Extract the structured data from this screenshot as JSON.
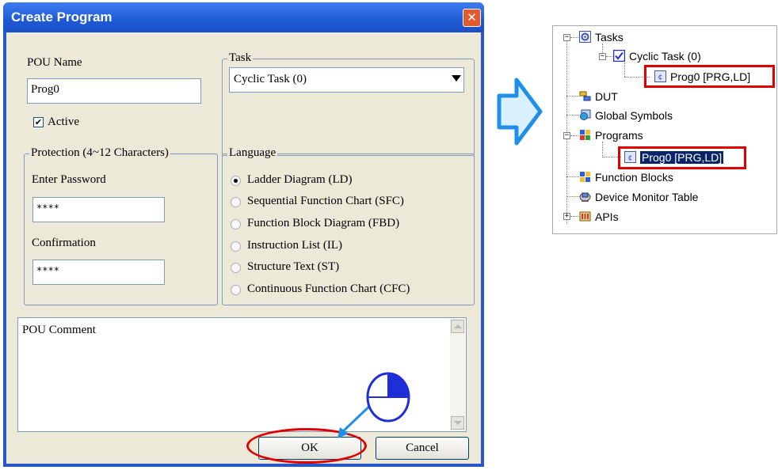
{
  "dialog": {
    "title": "Create Program",
    "close_glyph": "✕",
    "pou_name_label": "POU Name",
    "pou_name_value": "Prog0",
    "active_label": "Active",
    "active_checked": true,
    "task": {
      "legend": "Task",
      "selected": "Cyclic Task (0)"
    },
    "protection": {
      "legend": "Protection (4~12 Characters)",
      "password_label": "Enter Password",
      "password_value": "****",
      "confirmation_label": "Confirmation",
      "confirmation_value": "****"
    },
    "language": {
      "legend": "Language",
      "options": [
        {
          "label": "Ladder Diagram (LD)",
          "checked": true
        },
        {
          "label": "Sequential Function Chart (SFC)",
          "checked": false
        },
        {
          "label": "Function Block Diagram (FBD)",
          "checked": false
        },
        {
          "label": "Instruction List (IL)",
          "checked": false
        },
        {
          "label": "Structure Text (ST)",
          "checked": false
        },
        {
          "label": "Continuous Function Chart (CFC)",
          "checked": false
        }
      ]
    },
    "comment_placeholder": "POU Comment",
    "ok_label": "OK",
    "cancel_label": "Cancel"
  },
  "tree": {
    "items": [
      {
        "label": "Tasks",
        "icon": "gear-icon"
      },
      {
        "label": "Cyclic Task (0)",
        "icon": "checkbox-icon"
      },
      {
        "label": "Prog0 [PRG,LD]",
        "icon": "program-icon"
      },
      {
        "label": "DUT",
        "icon": "dut-icon"
      },
      {
        "label": "Global Symbols",
        "icon": "globe-icon"
      },
      {
        "label": "Programs",
        "icon": "programs-icon"
      },
      {
        "label": "Prog0 [PRG,LD]",
        "icon": "program-icon"
      },
      {
        "label": "Function Blocks",
        "icon": "function-blocks-icon"
      },
      {
        "label": "Device Monitor Table",
        "icon": "monitor-icon"
      },
      {
        "label": "APIs",
        "icon": "api-icon"
      }
    ]
  },
  "colors": {
    "titlebar": "#2a5fd8",
    "highlight": "#e00000",
    "arrow": "#1f8fe8",
    "selection": "#0a246a"
  }
}
